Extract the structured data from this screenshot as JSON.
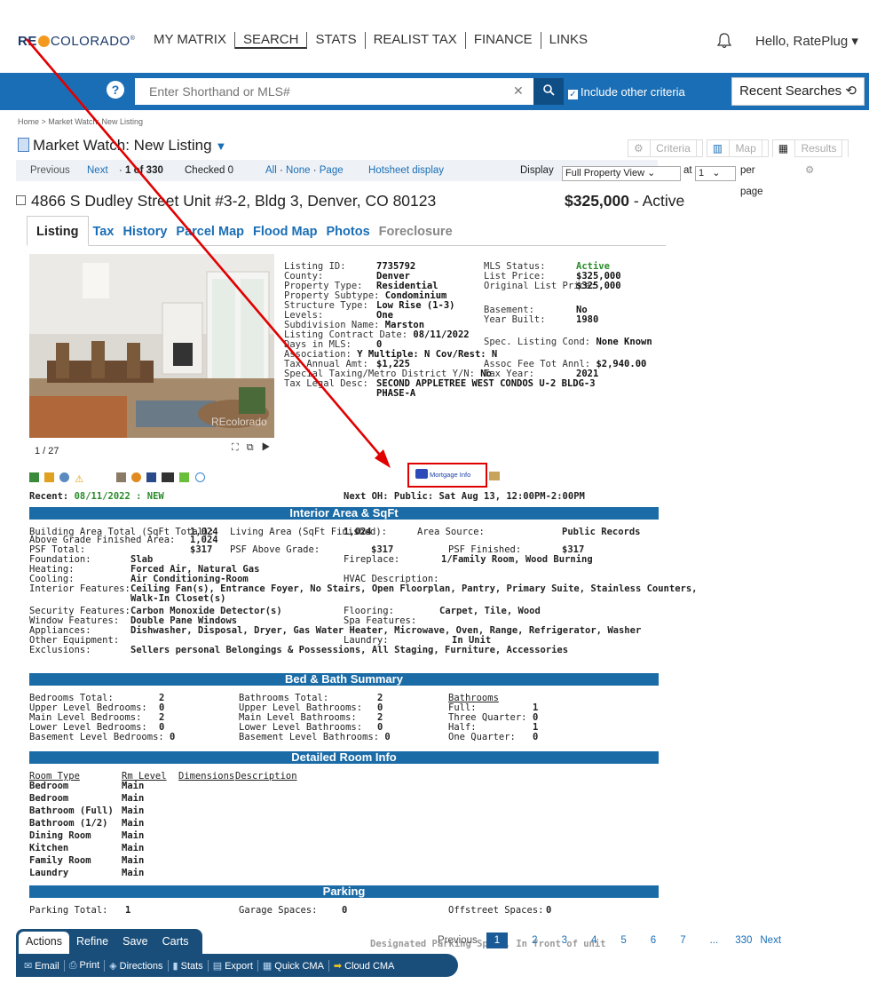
{
  "topnav": {
    "logo": "RE",
    "logo_word": "COLORADO",
    "menu": [
      "MY MATRIX",
      "SEARCH",
      "STATS",
      "REALIST TAX",
      "FINANCE",
      "LINKS"
    ],
    "greeting": "Hello, RatePlug ▾"
  },
  "search": {
    "placeholder": "Enter Shorthand or MLS#",
    "include_label": "Include other criteria",
    "recent_label": "Recent Searches ⟲"
  },
  "breadcrumb": "Home > Market Watch: New Listing",
  "page_title": "Market Watch: New Listing",
  "view_tabs": {
    "criteria": "Criteria",
    "map": "Map",
    "results": "Results"
  },
  "pager_top": {
    "previous": "Previous",
    "next": "Next",
    "count": "1 of 330",
    "checked": "Checked 0",
    "all": "All",
    "none": "None",
    "page": "Page",
    "hotsheet": "Hotsheet display",
    "display_label": "Display",
    "display_value": "Full Property View",
    "at_label": "at",
    "per_value": "1",
    "per_page": "per page"
  },
  "listing": {
    "address": "4866 S Dudley Street Unit #3-2, Bldg 3, Denver, CO 80123",
    "price": "$325,000",
    "status": "- Active"
  },
  "tabs": [
    "Listing",
    "Tax",
    "History",
    "Parcel Map",
    "Flood Map",
    "Photos",
    "Foreclosure"
  ],
  "photo": {
    "counter": "1 / 27",
    "watermark": "REcolorado"
  },
  "facts_left": [
    {
      "label": "Listing ID:",
      "value": "7735792"
    },
    {
      "label": "County:",
      "value": "Denver"
    },
    {
      "label": "Property Type:",
      "value": "Residential"
    },
    {
      "label": "Property Subtype:",
      "value": "Condominium"
    },
    {
      "label": "Structure Type:",
      "value": "Low Rise (1-3)"
    },
    {
      "label": "Levels:",
      "value": "One"
    },
    {
      "label": "Subdivision Name:",
      "value": "Marston"
    },
    {
      "label": "Listing Contract Date:",
      "value": "08/11/2022"
    },
    {
      "label": "Days in MLS:",
      "value": "0"
    },
    {
      "label": "Association:",
      "value": "Y  Multiple: N  Cov/Rest: N"
    },
    {
      "label": "Tax Annual Amt:",
      "value": "$1,225"
    },
    {
      "label": "Special Taxing/Metro District Y/N:",
      "value": "No"
    },
    {
      "label": "Tax Legal Desc:",
      "value": "SECOND APPLETREE WEST CONDOS U-2 BLDG-3"
    },
    {
      "label": "",
      "value": "PHASE-A"
    }
  ],
  "facts_right": [
    {
      "label": "MLS Status:",
      "value": "Active"
    },
    {
      "label": "List Price:",
      "value": "$325,000"
    },
    {
      "label": "Original List Price:",
      "value": "$325,000"
    },
    {
      "label": "Basement:",
      "value": "No"
    },
    {
      "label": "Year Built:",
      "value": "1980"
    },
    {
      "label": "Spec. Listing Cond:",
      "value": "None Known"
    },
    {
      "label": "Assoc Fee Tot Annl:",
      "value": "$2,940.00"
    },
    {
      "label": "Tax Year:",
      "value": "2021"
    }
  ],
  "mortgage_label": "Mortgage Info",
  "recent": {
    "label": "Recent:",
    "value": "08/11/2022 : NEW"
  },
  "next_oh": {
    "label": "Next OH:",
    "value": "Public: Sat Aug 13, 12:00PM-2:00PM"
  },
  "sections": {
    "interior": "Interior Area & SqFt",
    "bedbath": "Bed & Bath Summary",
    "rooms": "Detailed Room Info",
    "parking": "Parking"
  },
  "interior": {
    "bldg_area_label": "Building Area Total (SqFt Total):",
    "bldg_area": "1,024",
    "living_label": "Living Area (SqFt Finished):",
    "living": "1,024",
    "area_source_label": "Area Source:",
    "area_source": "Public Records",
    "above_grade_label": "Above Grade Finished Area:",
    "above_grade": "1,024",
    "psf_total_label": "PSF Total:",
    "psf_total": "$317",
    "psf_above_label": "PSF Above Grade:",
    "psf_above": "$317",
    "psf_finished_label": "PSF Finished:",
    "psf_finished": "$317",
    "foundation_label": "Foundation:",
    "foundation": "Slab",
    "fireplace_label": "Fireplace:",
    "fireplace": "1/Family Room, Wood Burning",
    "heating_label": "Heating:",
    "heating": "Forced Air, Natural Gas",
    "cooling_label": "Cooling:",
    "cooling": "Air Conditioning-Room",
    "hvac_label": "HVAC Description:",
    "interior_label": "Interior Features:",
    "interior_1": "Ceiling Fan(s), Entrance Foyer, No Stairs, Open Floorplan, Pantry, Primary Suite, Stainless Counters,",
    "interior_2": "Walk-In Closet(s)",
    "security_label": "Security Features:",
    "security": "Carbon Monoxide Detector(s)",
    "flooring_label": "Flooring:",
    "flooring": "Carpet, Tile, Wood",
    "window_label": "Window Features:",
    "window": "Double Pane Windows",
    "spa_label": "Spa Features:",
    "appliances_label": "Appliances:",
    "appliances": "Dishwasher, Disposal, Dryer, Gas Water Heater, Microwave, Oven, Range, Refrigerator, Washer",
    "other_label": "Other Equipment:",
    "laundry_label": "Laundry:",
    "laundry": "In Unit",
    "exclusions_label": "Exclusions:",
    "exclusions": "Sellers personal Belongings & Possessions, All Staging, Furniture, Accessories"
  },
  "bedbath": {
    "col1": [
      {
        "label": "Bedrooms Total:",
        "value": "2"
      },
      {
        "label": "Upper Level Bedrooms:",
        "value": "0"
      },
      {
        "label": "Main Level Bedrooms:",
        "value": "2"
      },
      {
        "label": "Lower Level Bedrooms:",
        "value": "0"
      },
      {
        "label": "Basement Level Bedrooms:",
        "value": "0"
      }
    ],
    "col2": [
      {
        "label": "Bathrooms Total:",
        "value": "2"
      },
      {
        "label": "Upper Level Bathrooms:",
        "value": "0"
      },
      {
        "label": "Main Level Bathrooms:",
        "value": "2"
      },
      {
        "label": "Lower Level Bathrooms:",
        "value": "0"
      },
      {
        "label": "Basement Level Bathrooms:",
        "value": "0"
      }
    ],
    "col3_head": "Bathrooms",
    "col3": [
      {
        "label": "Full:",
        "value": "1"
      },
      {
        "label": "Three Quarter:",
        "value": "0"
      },
      {
        "label": "Half:",
        "value": "1"
      },
      {
        "label": "One Quarter:",
        "value": "0"
      }
    ]
  },
  "rooms": {
    "headers": [
      "Room Type",
      "Rm Level",
      "Dimensions",
      "Description"
    ],
    "rows": [
      {
        "type": "Bedroom",
        "level": "Main"
      },
      {
        "type": "Bedroom",
        "level": "Main"
      },
      {
        "type": "Bathroom (Full)",
        "level": "Main"
      },
      {
        "type": "Bathroom (1/2)",
        "level": "Main"
      },
      {
        "type": "Dining Room",
        "level": "Main"
      },
      {
        "type": "Kitchen",
        "level": "Main"
      },
      {
        "type": "Family Room",
        "level": "Main"
      },
      {
        "type": "Laundry",
        "level": "Main"
      }
    ]
  },
  "parking": {
    "total_label": "Parking Total:",
    "total": "1",
    "garage_label": "Garage Spaces:",
    "garage": "0",
    "offstreet_label": "Offstreet Spaces:",
    "offstreet": "0",
    "designated": "Designated Parking Space, In front of unit"
  },
  "action_tabs": [
    "Actions",
    "Refine",
    "Save",
    "Carts"
  ],
  "action_buttons": [
    "Email",
    "Print",
    "Directions",
    "Stats",
    "Export",
    "Quick CMA",
    "Cloud CMA"
  ],
  "pager_bottom": {
    "previous": "Previous",
    "pages": [
      "1",
      "2",
      "3",
      "4",
      "5",
      "6",
      "7",
      "...",
      "330"
    ],
    "next": "Next"
  },
  "colors": {
    "brand_blue": "#1a6eb5",
    "section_blue": "#1a6ba6",
    "annotation_red": "#e10000",
    "active_green": "#2a8a2a"
  }
}
